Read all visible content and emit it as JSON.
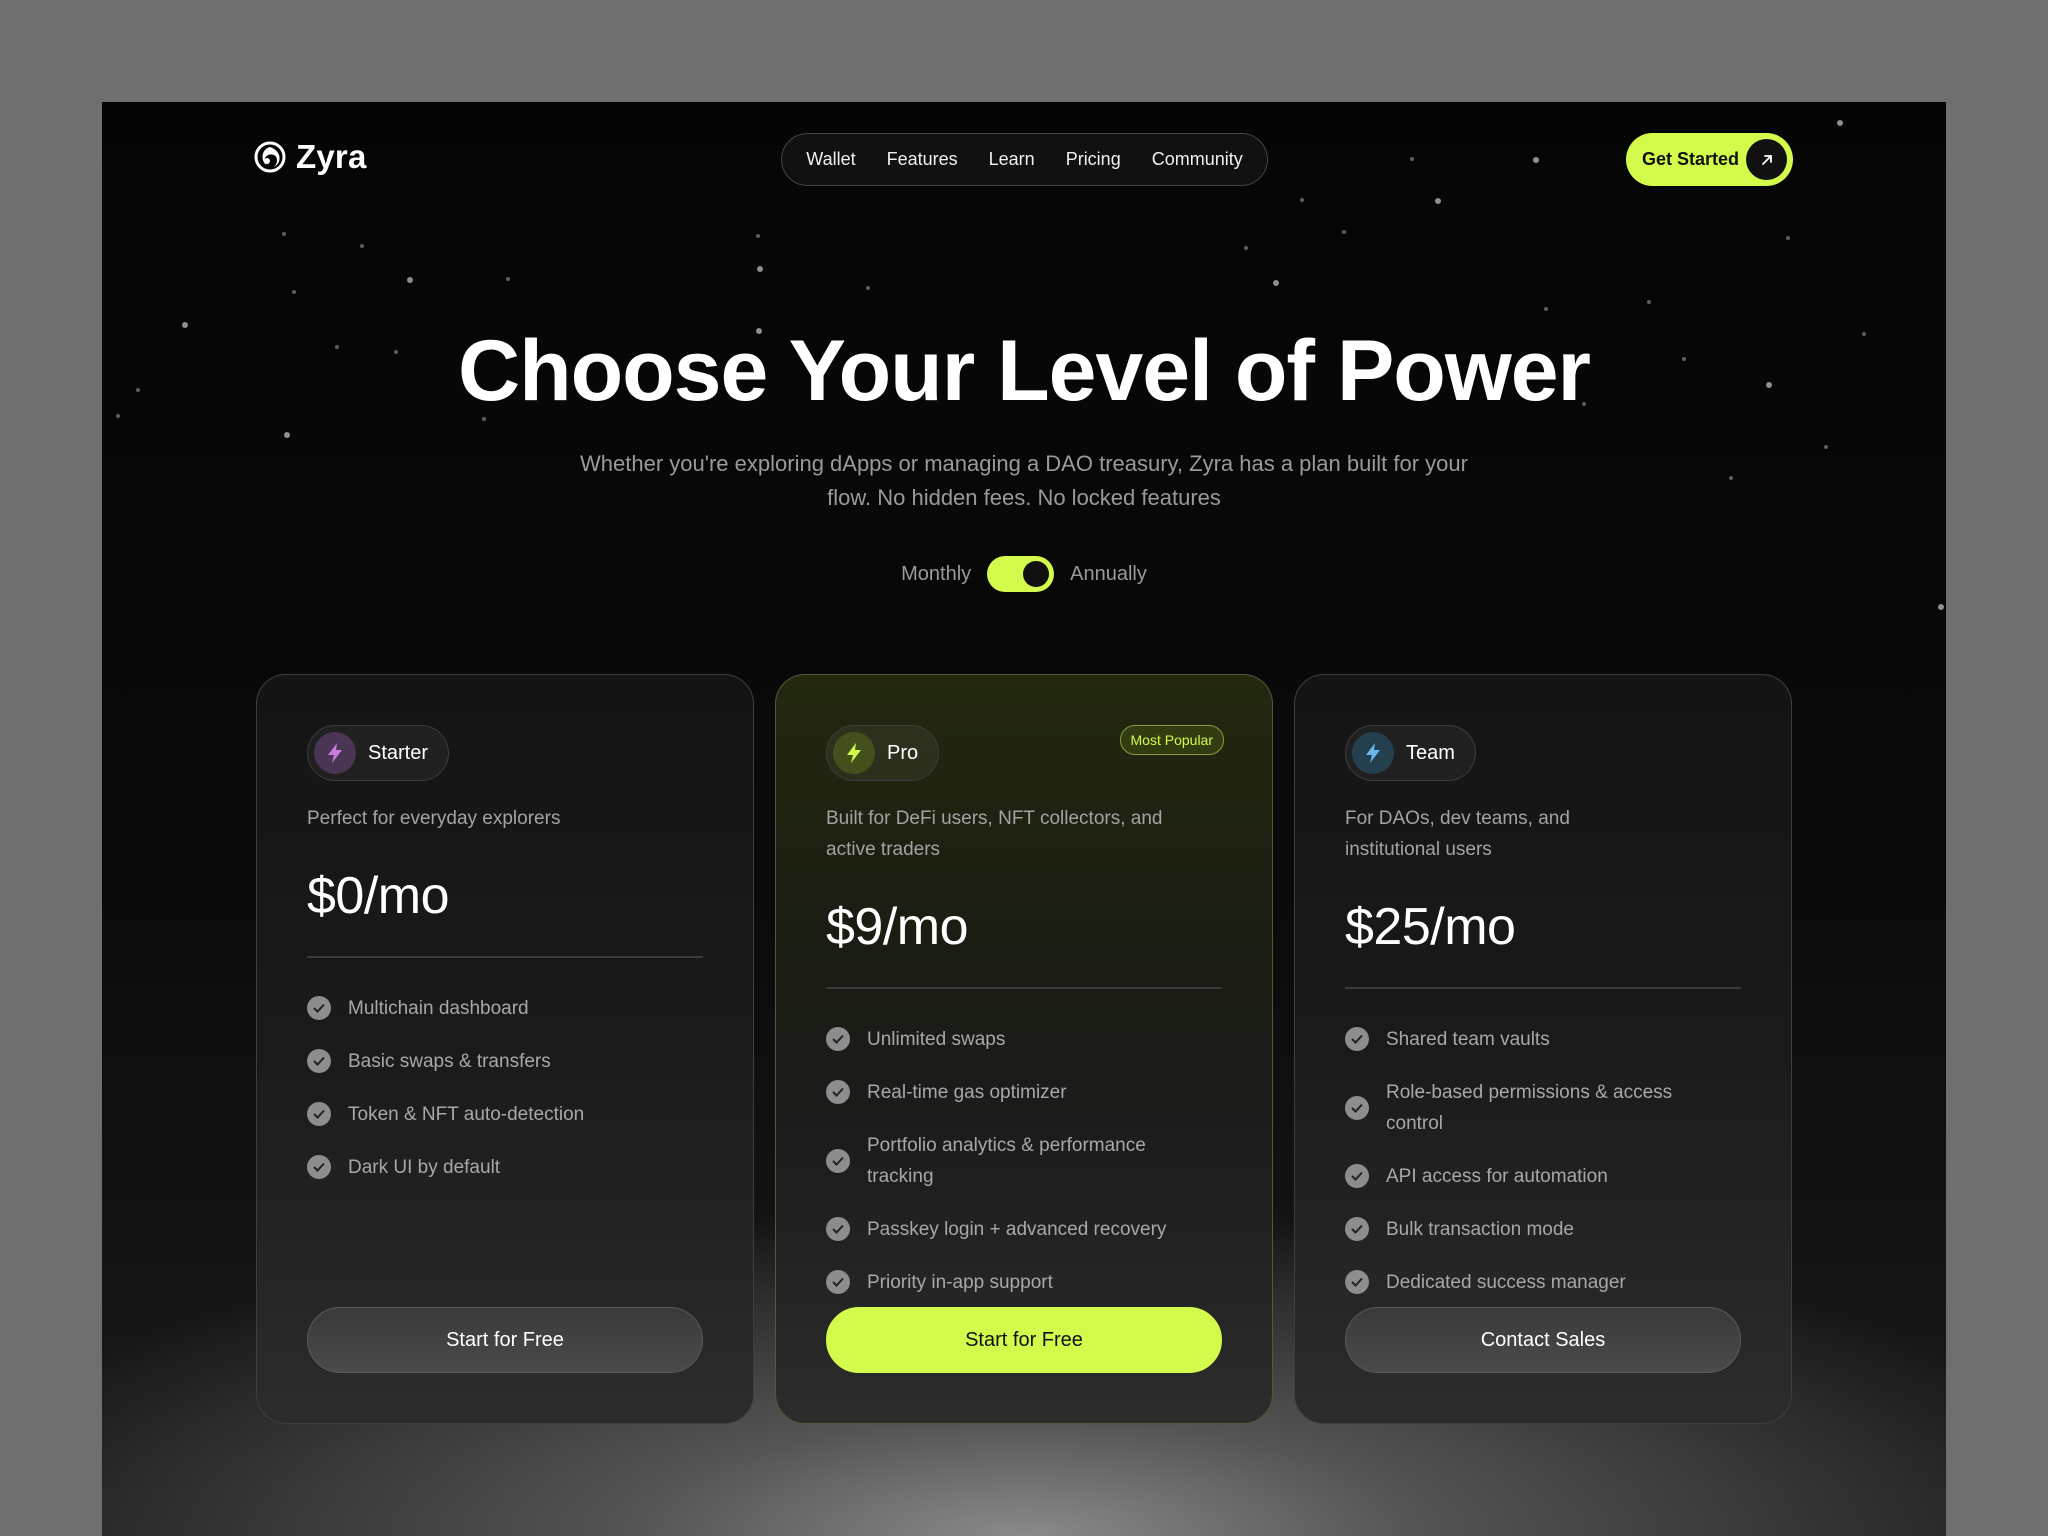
{
  "colors": {
    "accent": "#d2fb4c",
    "background": "#0a0a0a",
    "starter_icon": "#c97be0",
    "pro_icon": "#d2fb4c",
    "team_icon": "#6ab8f0"
  },
  "brand": {
    "name": "Zyra",
    "logo_icon": "yin-swirl-icon"
  },
  "nav": {
    "items": [
      "Wallet",
      "Features",
      "Learn",
      "Pricing",
      "Community"
    ]
  },
  "header": {
    "cta_label": "Get Started",
    "cta_icon": "arrow-up-right-icon"
  },
  "hero": {
    "title": "Choose Your Level of Power",
    "subtitle": "Whether you're exploring dApps or managing a DAO treasury, Zyra has a plan built for your flow. No hidden fees. No locked features",
    "billing_toggle": {
      "left_label": "Monthly",
      "right_label": "Annually",
      "selected": "Annually"
    }
  },
  "plans": [
    {
      "name": "Starter",
      "icon": "lightning-icon",
      "description": "Perfect for everyday explorers",
      "price": "$0/mo",
      "features": [
        "Multichain dashboard",
        "Basic swaps & transfers",
        "Token & NFT auto-detection",
        "Dark UI by default"
      ],
      "button_label": "Start for Free"
    },
    {
      "name": "Pro",
      "icon": "lightning-icon",
      "badge": "Most Popular",
      "description": "Built for DeFi users, NFT collectors, and active traders",
      "price": "$9/mo",
      "features": [
        "Unlimited swaps",
        "Real-time gas optimizer",
        "Portfolio analytics & performance tracking",
        "Passkey login + advanced recovery",
        "Priority in-app support"
      ],
      "button_label": "Start for Free"
    },
    {
      "name": "Team",
      "icon": "lightning-icon",
      "description": "For DAOs, dev teams, and institutional users",
      "price": "$25/mo",
      "features": [
        "Shared team vaults",
        "Role-based permissions & access control",
        "API access for automation",
        "Bulk transaction mode",
        "Dedicated success manager"
      ],
      "button_label": "Contact Sales"
    }
  ]
}
